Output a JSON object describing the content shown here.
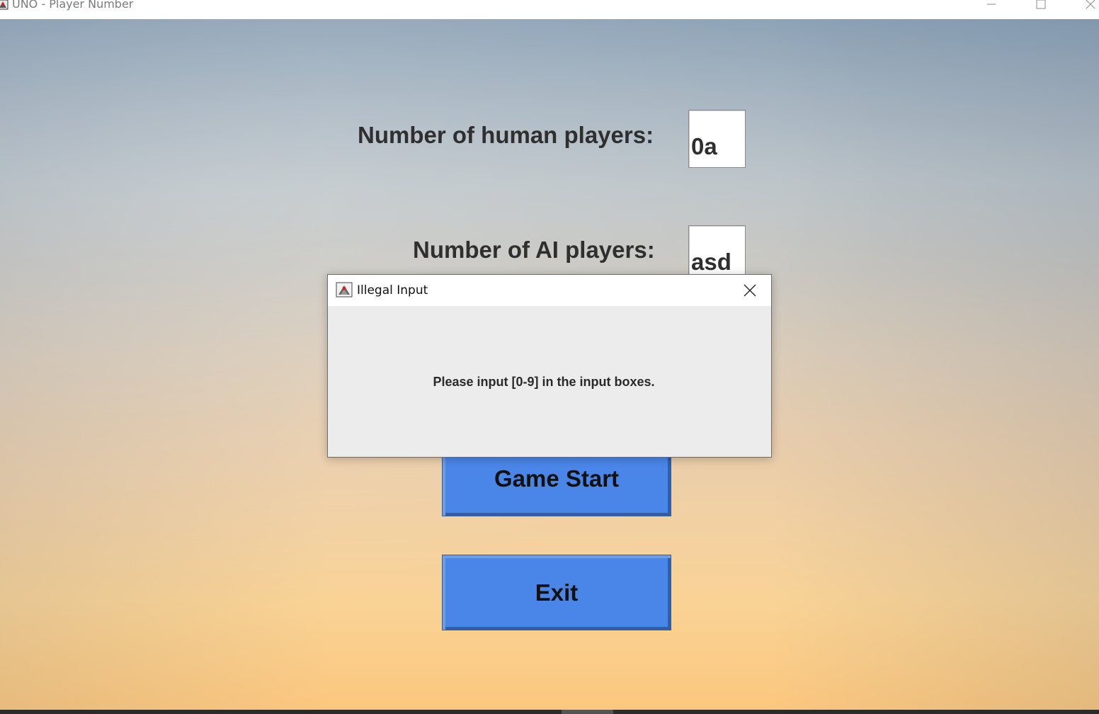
{
  "window": {
    "title": "UNO - Player Number",
    "icon": "java-app-icon",
    "controls": [
      "minimize-icon",
      "maximize-icon",
      "close-icon"
    ]
  },
  "form": {
    "human_label": "Number of human players:",
    "human_value": "0a",
    "ai_label": "Number of AI players:",
    "ai_value": "asd"
  },
  "buttons": {
    "start_label": "Game Start",
    "exit_label": "Exit",
    "color": "#4a86e8"
  },
  "dialog": {
    "title": "Illegal Input",
    "message": "Please input [0-9] in the input boxes.",
    "icon": "java-app-icon"
  }
}
